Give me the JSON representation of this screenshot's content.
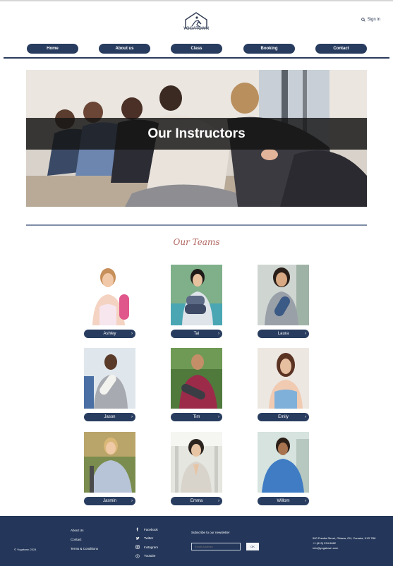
{
  "header": {
    "logo_text": "YOGATOWN",
    "signin_label": "Sign in"
  },
  "nav": {
    "items": [
      {
        "label": "Home"
      },
      {
        "label": "About us"
      },
      {
        "label": "Class"
      },
      {
        "label": "Booking"
      },
      {
        "label": "Contact"
      }
    ]
  },
  "hero": {
    "title": "Our Instructors"
  },
  "teams": {
    "title": "Our Teams",
    "instructors": [
      {
        "name": "Ashley"
      },
      {
        "name": "Tai"
      },
      {
        "name": "Laura"
      },
      {
        "name": "Jason"
      },
      {
        "name": "Tim"
      },
      {
        "name": "Emily"
      },
      {
        "name": "Jasmin"
      },
      {
        "name": "Emma"
      },
      {
        "name": "Willom"
      }
    ]
  },
  "footer": {
    "copyright": "© Yogatown 2024",
    "links": [
      {
        "label": "About Us"
      },
      {
        "label": "Contact"
      },
      {
        "label": "Terms & Conditions"
      }
    ],
    "social": [
      {
        "label": "Facebook",
        "icon": "facebook-icon"
      },
      {
        "label": "Twitter",
        "icon": "twitter-icon"
      },
      {
        "label": "Instagram",
        "icon": "instagram-icon"
      },
      {
        "label": "Youtube",
        "icon": "youtube-icon"
      }
    ],
    "newsletter_label": "Subscribe to our newsletter",
    "email_placeholder": "Email Address",
    "submit_label": "OK",
    "address": "500 Prestia Street, Ottawa, ON, Canada, K1S 7B8",
    "phone": "+1   (613) 234-5682",
    "email": "info@yogatown.com"
  },
  "colors": {
    "navy": "#283c5f",
    "accent_title": "#b0645e",
    "footer_bg": "#24375a"
  }
}
